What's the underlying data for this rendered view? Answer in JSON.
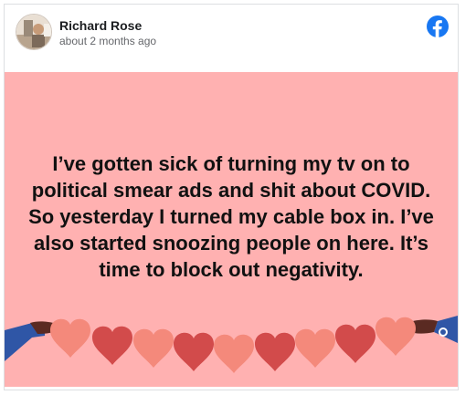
{
  "post": {
    "author": "Richard Rose",
    "timestamp": "about 2 months ago",
    "text": "I’ve gotten sick of turning my tv on to political smear ads and shit about COVID. So yesterday I turned my cable box in. I’ve also started snoozing people on here. It’s time to block out negativity.",
    "background_color": "#ffb1b1",
    "icon": "facebook-icon"
  },
  "colors": {
    "facebook_blue": "#1877f2",
    "heart_light": "#f4897b",
    "heart_dark": "#d24b4b"
  }
}
